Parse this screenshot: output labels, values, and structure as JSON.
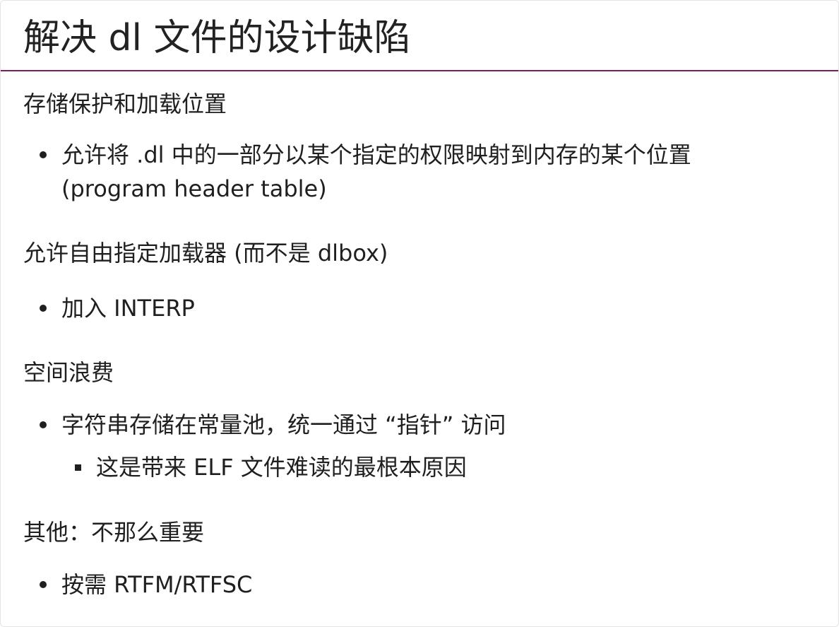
{
  "slide": {
    "title": "解决 dl 文件的设计缺陷",
    "sections": [
      {
        "heading": "存储保护和加载位置",
        "bullets": [
          {
            "text": "允许将 .dl 中的一部分以某个指定的权限映射到内存的某个位置 (program header table)"
          }
        ]
      },
      {
        "heading": "允许自由指定加载器 (而不是 dlbox)",
        "bullets": [
          {
            "text": "加入 INTERP"
          }
        ]
      },
      {
        "heading": "空间浪费",
        "bullets": [
          {
            "text": "字符串存储在常量池，统一通过 “指针” 访问",
            "subbullets": [
              {
                "text": "这是带来 ELF 文件难读的最根本原因"
              }
            ]
          }
        ]
      },
      {
        "heading": "其他：不那么重要",
        "bullets": [
          {
            "text": "按需 RTFM/RTFSC"
          }
        ]
      }
    ]
  }
}
